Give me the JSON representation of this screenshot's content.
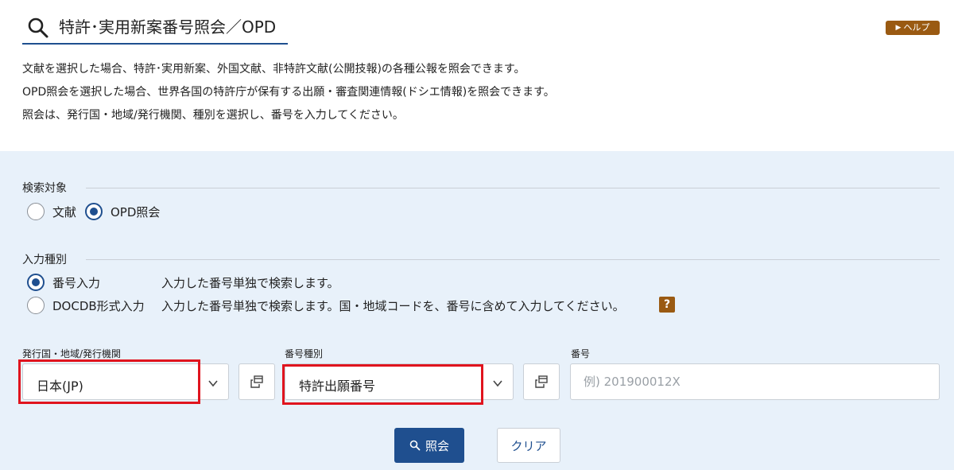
{
  "header": {
    "title": "特許･実用新案番号照会／OPD",
    "help_label": "ヘルプ",
    "description": [
      "文献を選択した場合、特許･実用新案、外国文献、非特許文献(公開技報)の各種公報を照会できます。",
      "OPD照会を選択した場合、世界各国の特許庁が保有する出願・審査関連情報(ドシエ情報)を照会できます。",
      "照会は、発行国・地域/発行機関、種別を選択し、番号を入力してください。"
    ]
  },
  "search_target": {
    "label": "検索対象",
    "options": [
      {
        "label": "文献",
        "checked": false
      },
      {
        "label": "OPD照会",
        "checked": true
      }
    ]
  },
  "input_type": {
    "label": "入力種別",
    "options": [
      {
        "label": "番号入力",
        "hint": "入力した番号単独で検索します。",
        "checked": true
      },
      {
        "label": "DOCDB形式入力",
        "hint": "入力した番号単独で検索します。国・地域コードを、番号に含めて入力してください。",
        "checked": false
      }
    ],
    "help_mark": "?"
  },
  "fields": {
    "country": {
      "label": "発行国・地域/発行機関",
      "value": "日本(JP)"
    },
    "number_type": {
      "label": "番号種別",
      "value": "特許出願番号"
    },
    "number": {
      "label": "番号",
      "placeholder": "例) 201900012X",
      "value": ""
    }
  },
  "actions": {
    "search_label": "照会",
    "clear_label": "クリア"
  },
  "colors": {
    "accent": "#1f4f8f",
    "help": "#9a5a12",
    "highlight": "#e0141e",
    "form_bg": "#e8f1fa"
  },
  "icons": [
    "search-icon",
    "chevron-down-icon",
    "popup-window-icon",
    "help-triangle-icon",
    "question-icon"
  ]
}
